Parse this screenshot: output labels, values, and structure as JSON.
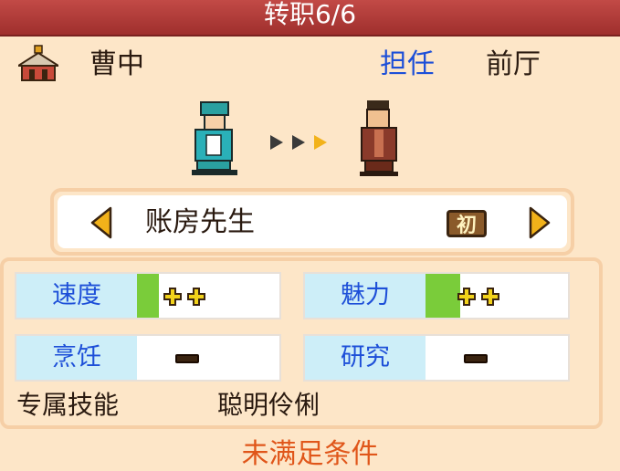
{
  "header": {
    "title": "转职6/6"
  },
  "character": {
    "name": "曹中",
    "assign_label": "担任",
    "location": "前厅"
  },
  "job": {
    "name": "账房先生",
    "rank_badge": "初"
  },
  "stats": [
    {
      "label": "速度",
      "value_icon": "double-plus-icon",
      "bar_level": 0.15
    },
    {
      "label": "魅力",
      "value_icon": "double-plus-icon",
      "bar_level": 0.25
    },
    {
      "label": "烹饪",
      "value_icon": "minus-icon",
      "bar_level": 0
    },
    {
      "label": "研究",
      "value_icon": "minus-icon",
      "bar_level": 0
    }
  ],
  "skill": {
    "label": "专属技能",
    "value": "聪明伶俐"
  },
  "condition_text": "未满足条件",
  "colors": {
    "title_bar": "#b23a38",
    "accent_blue": "#1d4fd8",
    "warning_orange": "#e0561a",
    "stat_bar": "#7acc3a"
  }
}
